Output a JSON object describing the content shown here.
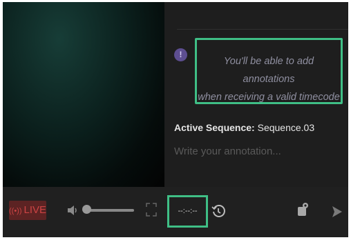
{
  "notice": {
    "line1": "You'll be able to add annotations",
    "line2": "when receiving a valid timecode"
  },
  "sequence": {
    "label": "Active Sequence:",
    "value": "Sequence.03"
  },
  "annotation": {
    "placeholder": "Write your annotation..."
  },
  "controls": {
    "live_label": "LIVE",
    "timecode": "--:--:--",
    "volume_level": 0.1
  },
  "colors": {
    "highlight": "#3fbf86",
    "live": "#cc4444",
    "info": "#5d4e91"
  },
  "icons": [
    "info-icon",
    "broadcast-icon",
    "speaker-icon",
    "fullscreen-icon",
    "history-icon",
    "marker-icon",
    "send-icon"
  ]
}
